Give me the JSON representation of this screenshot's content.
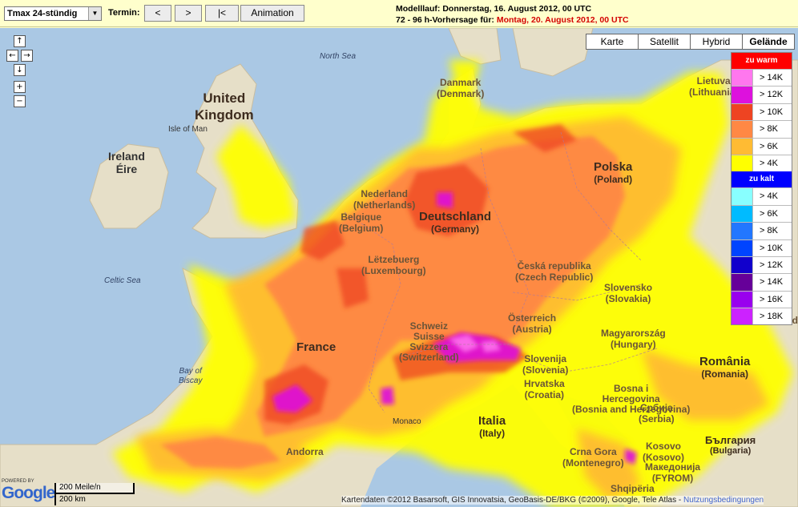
{
  "toolbar": {
    "product_value": "Tmax 24-stündig",
    "termin_label": "Termin:",
    "prev_label": "<",
    "next_label": ">",
    "first_label": "|<",
    "animation_label": "Animation"
  },
  "run_info": {
    "model_run": "Modelllauf: Donnerstag, 16. August 2012, 00 UTC",
    "forecast_prefix": "72 - 96 h-Vorhersage für:",
    "forecast_date": "Montag, 20. August 2012, 00 UTC"
  },
  "map_controls": {
    "up": "↑",
    "left": "←",
    "right": "→",
    "down": "↓",
    "zoom_in": "+",
    "zoom_out": "−"
  },
  "map_types": [
    {
      "label": "Karte",
      "active": false
    },
    {
      "label": "Satellit",
      "active": false
    },
    {
      "label": "Hybrid",
      "active": false
    },
    {
      "label": "Gelände",
      "active": true
    }
  ],
  "legend": {
    "warm_header": "zu warm",
    "warm_color": "#ff0000",
    "warm": [
      {
        "label": "> 14K",
        "color": "#ff77ee"
      },
      {
        "label": "> 12K",
        "color": "#dd11dd"
      },
      {
        "label": "> 10K",
        "color": "#ee4422"
      },
      {
        "label": "> 8K",
        "color": "#ff8844"
      },
      {
        "label": "> 6K",
        "color": "#ffbb33"
      },
      {
        "label": "> 4K",
        "color": "#ffff00"
      }
    ],
    "cold_header": "zu kalt",
    "cold_color": "#0000ff",
    "cold": [
      {
        "label": "> 4K",
        "color": "#88ffff"
      },
      {
        "label": "> 6K",
        "color": "#00bbff"
      },
      {
        "label": "> 8K",
        "color": "#2277ff"
      },
      {
        "label": "> 10K",
        "color": "#0044ff"
      },
      {
        "label": "> 12K",
        "color": "#1100cc"
      },
      {
        "label": "> 14K",
        "color": "#660099"
      },
      {
        "label": "> 16K",
        "color": "#9900ee"
      },
      {
        "label": "> 18K",
        "color": "#cc22ff"
      }
    ]
  },
  "places": {
    "north_sea": "North Sea",
    "danmark": "Danmark",
    "danmark_sub": "(Denmark)",
    "lietuva": "Lietuva",
    "lietuva_sub": "(Lithuania)",
    "uk1": "United",
    "uk2": "Kingdom",
    "isle_of_man": "Isle of Man",
    "ireland": "Ireland",
    "eire": "Éire",
    "nederland": "Nederland",
    "nederland_sub": "(Netherlands)",
    "belgique": "Belgique",
    "belgique_sub": "(Belgium)",
    "deutschland": "Deutschland",
    "deutschland_sub": "(Germany)",
    "polska": "Polska",
    "polska_sub": "(Poland)",
    "letzebuerg": "Lëtzebuerg",
    "letzebuerg_sub": "(Luxembourg)",
    "celtic_sea": "Celtic Sea",
    "ceska": "Česká republika",
    "ceska_sub": "(Czech Republic)",
    "slovensko": "Slovensko",
    "slovensko_sub": "(Slovakia)",
    "osterreich": "Österreich",
    "osterreich_sub": "(Austria)",
    "schweiz1": "Schweiz",
    "schweiz2": "Suisse",
    "schweiz3": "Svizzera",
    "schweiz_sub": "(Switzerland)",
    "france": "France",
    "magyarorszag": "Magyarország",
    "magyarorszag_sub": "(Hungary)",
    "bay_of_biscay1": "Bay of",
    "bay_of_biscay2": "Biscay",
    "slovenija": "Slovenija",
    "slovenija_sub": "(Slovenia)",
    "hrvatska": "Hrvatska",
    "hrvatska_sub": "(Croatia)",
    "romania": "România",
    "romania_sub": "(Romania)",
    "bosna1": "Bosna i",
    "bosna2": "Hercegovina",
    "bosna_sub": "(Bosnia and Herzegovina)",
    "srbija": "Србија",
    "srbija_sub": "(Serbia)",
    "monaco": "Monaco",
    "italia": "Italia",
    "italia_sub": "(Italy)",
    "andorra": "Andorra",
    "crna_gora": "Crna Gora",
    "crna_gora_sub": "(Montenegro)",
    "kosovo": "Kosovo",
    "kosovo_sub": "(Kosovo)",
    "bulgaria": "България",
    "bulgaria_sub": "(Bulgaria)",
    "makedonija": "Македонија",
    "makedonija_sub": "(FYROM)",
    "shqiperia": "Shqipëria",
    "mold": "Mold"
  },
  "scale": {
    "miles": "200 Meile/n",
    "km": "200 km"
  },
  "logo": {
    "powered": "POWERED BY",
    "name": "Google"
  },
  "copyright": {
    "text": "Kartendaten ©2012 Basarsoft, GIS Innovatsia, GeoBasis-DE/BKG (©2009), Google, Tele Atlas -",
    "link": "Nutzungsbedingungen"
  }
}
